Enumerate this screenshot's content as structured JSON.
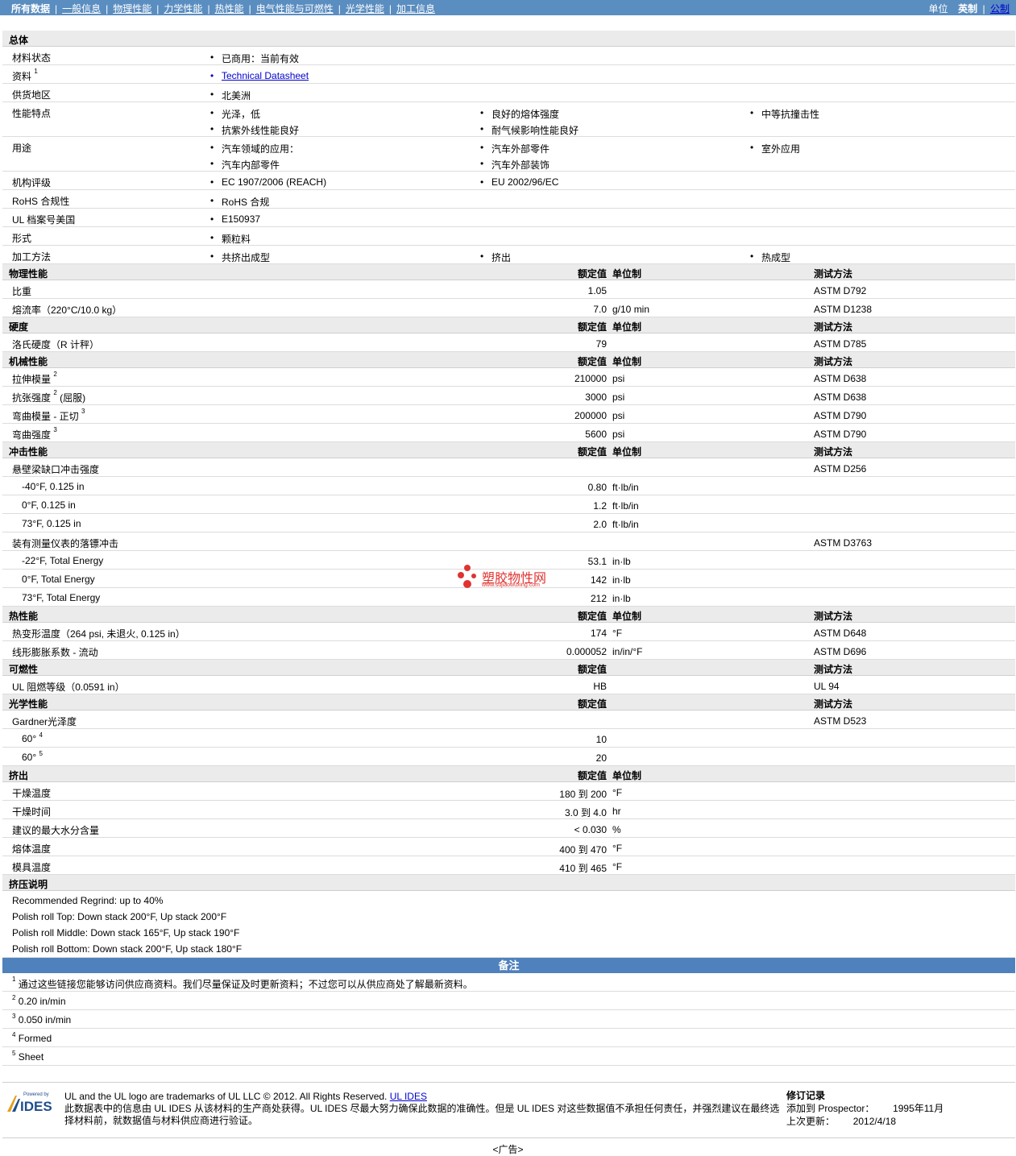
{
  "nav": {
    "tabs": [
      "所有数据",
      "一般信息",
      "物理性能",
      "力学性能",
      "热性能",
      "电气性能与可燃性",
      "光学性能",
      "加工信息"
    ],
    "separator": "|",
    "units_label": "单位",
    "units_selected": "英制",
    "units_sep": "|",
    "units_alt": "公制"
  },
  "general": {
    "title": "总体",
    "rows": [
      {
        "label": "材料状态",
        "items": [
          "已商用：当前有效"
        ]
      },
      {
        "label": "资料",
        "sup": "1",
        "items": [
          "Technical Datasheet"
        ],
        "link": true
      },
      {
        "label": "供货地区",
        "items": [
          "北美洲"
        ]
      },
      {
        "label": "性能特点",
        "items": [
          "光泽，低",
          "良好的熔体强度",
          "中等抗撞击性",
          "抗紫外线性能良好",
          "耐气候影响性能良好"
        ]
      },
      {
        "label": "用途",
        "items": [
          "汽车领域的应用：",
          "汽车外部零件",
          "室外应用",
          "汽车内部零件",
          "汽车外部装饰"
        ]
      },
      {
        "label": "机构评级",
        "items": [
          "EC 1907/2006 (REACH)",
          "EU 2002/96/EC"
        ]
      },
      {
        "label": "RoHS 合规性",
        "items": [
          "RoHS 合规"
        ]
      },
      {
        "label": "UL 档案号美国",
        "items": [
          "E150937"
        ]
      },
      {
        "label": "形式",
        "items": [
          "颗粒料"
        ]
      },
      {
        "label": "加工方法",
        "items": [
          "共挤出成型",
          "挤出",
          "热成型"
        ]
      }
    ]
  },
  "headers": {
    "nominal": "额定值",
    "unit": "单位制",
    "method": "测试方法"
  },
  "sections": [
    {
      "title": "物理性能",
      "show_unit": true,
      "show_method": true,
      "rows": [
        {
          "label": "比重",
          "value": "1.05",
          "unit": "",
          "method": "ASTM D792"
        },
        {
          "label": "熔流率（220°C/10.0 kg）",
          "value": "7.0",
          "unit": "g/10 min",
          "method": "ASTM D1238"
        }
      ]
    },
    {
      "title": "硬度",
      "show_unit": true,
      "show_method": true,
      "rows": [
        {
          "label": "洛氏硬度（R 计秤）",
          "value": "79",
          "unit": "",
          "method": "ASTM D785"
        }
      ]
    },
    {
      "title": "机械性能",
      "show_unit": true,
      "show_method": true,
      "rows": [
        {
          "label": "拉伸模量",
          "sup": "2",
          "suffix": "",
          "value": "210000",
          "unit": "psi",
          "method": "ASTM D638"
        },
        {
          "label": "抗张强度",
          "sup": "2",
          "suffix": " (屈服)",
          "value": "3000",
          "unit": "psi",
          "method": "ASTM D638"
        },
        {
          "label": "弯曲模量 - 正切",
          "sup": "3",
          "suffix": "",
          "value": "200000",
          "unit": "psi",
          "method": "ASTM D790"
        },
        {
          "label": "弯曲强度",
          "sup": "3",
          "suffix": "",
          "value": "5600",
          "unit": "psi",
          "method": "ASTM D790"
        }
      ]
    },
    {
      "title": "冲击性能",
      "show_unit": true,
      "show_method": true,
      "rows": [
        {
          "label": "悬壁梁缺口冲击强度",
          "value": "",
          "unit": "",
          "method": "ASTM D256"
        },
        {
          "label": "-40°F, 0.125 in",
          "indent": true,
          "value": "0.80",
          "unit": "ft·lb/in",
          "method": ""
        },
        {
          "label": "0°F, 0.125 in",
          "indent": true,
          "value": "1.2",
          "unit": "ft·lb/in",
          "method": ""
        },
        {
          "label": "73°F, 0.125 in",
          "indent": true,
          "value": "2.0",
          "unit": "ft·lb/in",
          "method": ""
        },
        {
          "label": "装有测量仪表的落镖冲击",
          "value": "",
          "unit": "",
          "method": "ASTM D3763"
        },
        {
          "label": "-22°F, Total Energy",
          "indent": true,
          "value": "53.1",
          "unit": "in·lb",
          "method": ""
        },
        {
          "label": "0°F, Total Energy",
          "indent": true,
          "value": "142",
          "unit": "in·lb",
          "method": ""
        },
        {
          "label": "73°F, Total Energy",
          "indent": true,
          "value": "212",
          "unit": "in·lb",
          "method": ""
        }
      ]
    },
    {
      "title": "热性能",
      "show_unit": true,
      "show_method": true,
      "rows": [
        {
          "label": "热变形温度（264 psi, 未退火, 0.125 in）",
          "value": "174",
          "unit": "°F",
          "method": "ASTM D648"
        },
        {
          "label": "线形膨胀系数 - 流动",
          "value": "0.000052",
          "unit": "in/in/°F",
          "method": "ASTM D696"
        }
      ]
    },
    {
      "title": "可燃性",
      "show_unit": false,
      "show_method": true,
      "rows": [
        {
          "label": "UL 阻燃等级（0.0591 in）",
          "value": "HB",
          "unit": "",
          "method": "UL 94"
        }
      ]
    },
    {
      "title": "光学性能",
      "show_unit": false,
      "show_method": true,
      "rows": [
        {
          "label": "Gardner光泽度",
          "value": "",
          "unit": "",
          "method": "ASTM D523"
        },
        {
          "label": "60°",
          "sup": "4",
          "indent": true,
          "value": "10",
          "unit": "",
          "method": ""
        },
        {
          "label": "60°",
          "sup": "5",
          "indent": true,
          "value": "20",
          "unit": "",
          "method": ""
        }
      ]
    },
    {
      "title": "挤出",
      "show_unit": true,
      "show_method": false,
      "rows": [
        {
          "label": "干燥温度",
          "value": "180 到  200",
          "unit": "°F",
          "method": ""
        },
        {
          "label": "干燥时间",
          "value": "3.0 到  4.0",
          "unit": "hr",
          "method": ""
        },
        {
          "label": "建议的最大水分含量",
          "value": "< 0.030",
          "unit": "%",
          "method": ""
        },
        {
          "label": "熔体温度",
          "value": "400 到  470",
          "unit": "°F",
          "method": ""
        },
        {
          "label": "模具温度",
          "value": "410 到  465",
          "unit": "°F",
          "method": ""
        }
      ]
    }
  ],
  "extrusion_notes": {
    "title": "挤压说明",
    "lines": [
      "Recommended Regrind: up to 40%",
      "Polish roll Top: Down stack 200°F, Up stack 200°F",
      "Polish roll Middle: Down stack 165°F, Up stack 190°F",
      "Polish roll Bottom: Down stack 200°F, Up stack 180°F"
    ]
  },
  "notes": {
    "title": "备注",
    "items": [
      {
        "num": "1",
        "text": "通过这些链接您能够访问供应商资料。我们尽量保证及时更新资料；不过您可以从供应商处了解最新资料。"
      },
      {
        "num": "2",
        "text": "0.20 in/min"
      },
      {
        "num": "3",
        "text": "0.050 in/min"
      },
      {
        "num": "4",
        "text": "Formed"
      },
      {
        "num": "5",
        "text": "Sheet"
      }
    ]
  },
  "watermark": {
    "text": "塑胶物性网",
    "url": "www.sujiaowuxing.com",
    "color": "#e0332f"
  },
  "footer": {
    "logo_top": "Powered by",
    "logo_text": "IDES",
    "legal_line1": "UL and the UL logo are trademarks of UL LLC © 2012. All Rights Reserved.",
    "legal_link": "UL IDES",
    "legal_line2": "此数据表中的信息由 UL IDES 从该材料的生产商处获得。UL IDES 尽最大努力确保此数据的准确性。但是 UL IDES 对这些数据值不承担任何责任，并强烈建议在最终选择材料前，就数据值与材料供应商进行验证。",
    "rev_title": "修订记录",
    "rev_added_label": "添加到 Prospector：",
    "rev_added_value": "1995年11月",
    "rev_updated_label": "上次更新：",
    "rev_updated_value": "2012/4/18"
  },
  "ad_label": "<广告>",
  "colors": {
    "topbar": "#5a8dc0",
    "notes_header": "#4f81bd",
    "section_bg": "#ebebeb",
    "link": "#0000cc"
  }
}
